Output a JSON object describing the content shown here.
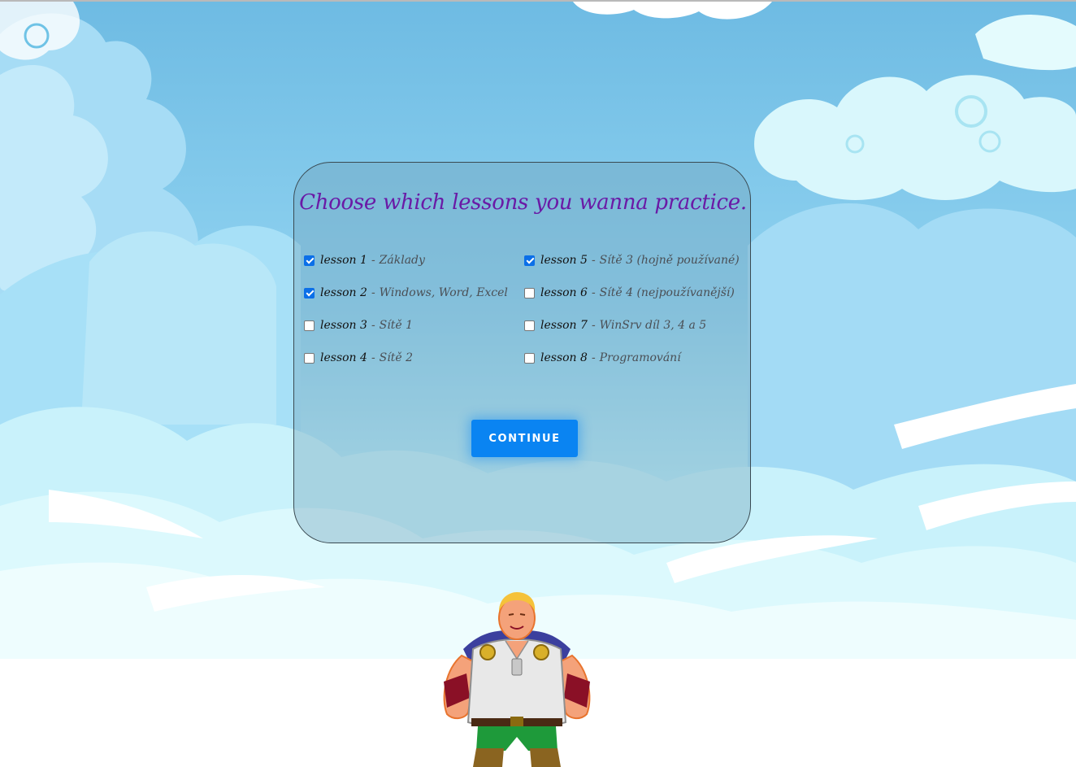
{
  "page": {
    "title": "Choose which lessons you wanna practice."
  },
  "lessons": [
    {
      "label": "lesson 1",
      "separator": "-",
      "topic": "Základy",
      "checked": true
    },
    {
      "label": "lesson 2",
      "separator": "-",
      "topic": "Windows, Word, Excel",
      "checked": true
    },
    {
      "label": "lesson 3",
      "separator": "-",
      "topic": "Sítě 1",
      "checked": false
    },
    {
      "label": "lesson 4",
      "separator": "-",
      "topic": "Sítě 2",
      "checked": false
    },
    {
      "label": "lesson 5",
      "separator": "-",
      "topic": "Sítě 3 (hojně používané)",
      "checked": true
    },
    {
      "label": "lesson 6",
      "separator": "-",
      "topic": "Sítě 4 (nejpoužívanější)",
      "checked": false
    },
    {
      "label": "lesson 7",
      "separator": "-",
      "topic": "WinSrv díl 3, 4 a 5",
      "checked": false
    },
    {
      "label": "lesson 8",
      "separator": "-",
      "topic": "Programování",
      "checked": false
    }
  ],
  "continue_button": {
    "label": "CONTINUE"
  },
  "colors": {
    "title": "#6a1aa6",
    "button": "#0a84f2",
    "checkbox_checked": "#0b6fe8",
    "sky_top": "#6ebbe3",
    "sky_bottom": "#d8f8fd"
  },
  "illustrations": {
    "background": "cartoon-clouds",
    "character": "viking-hero-character"
  }
}
